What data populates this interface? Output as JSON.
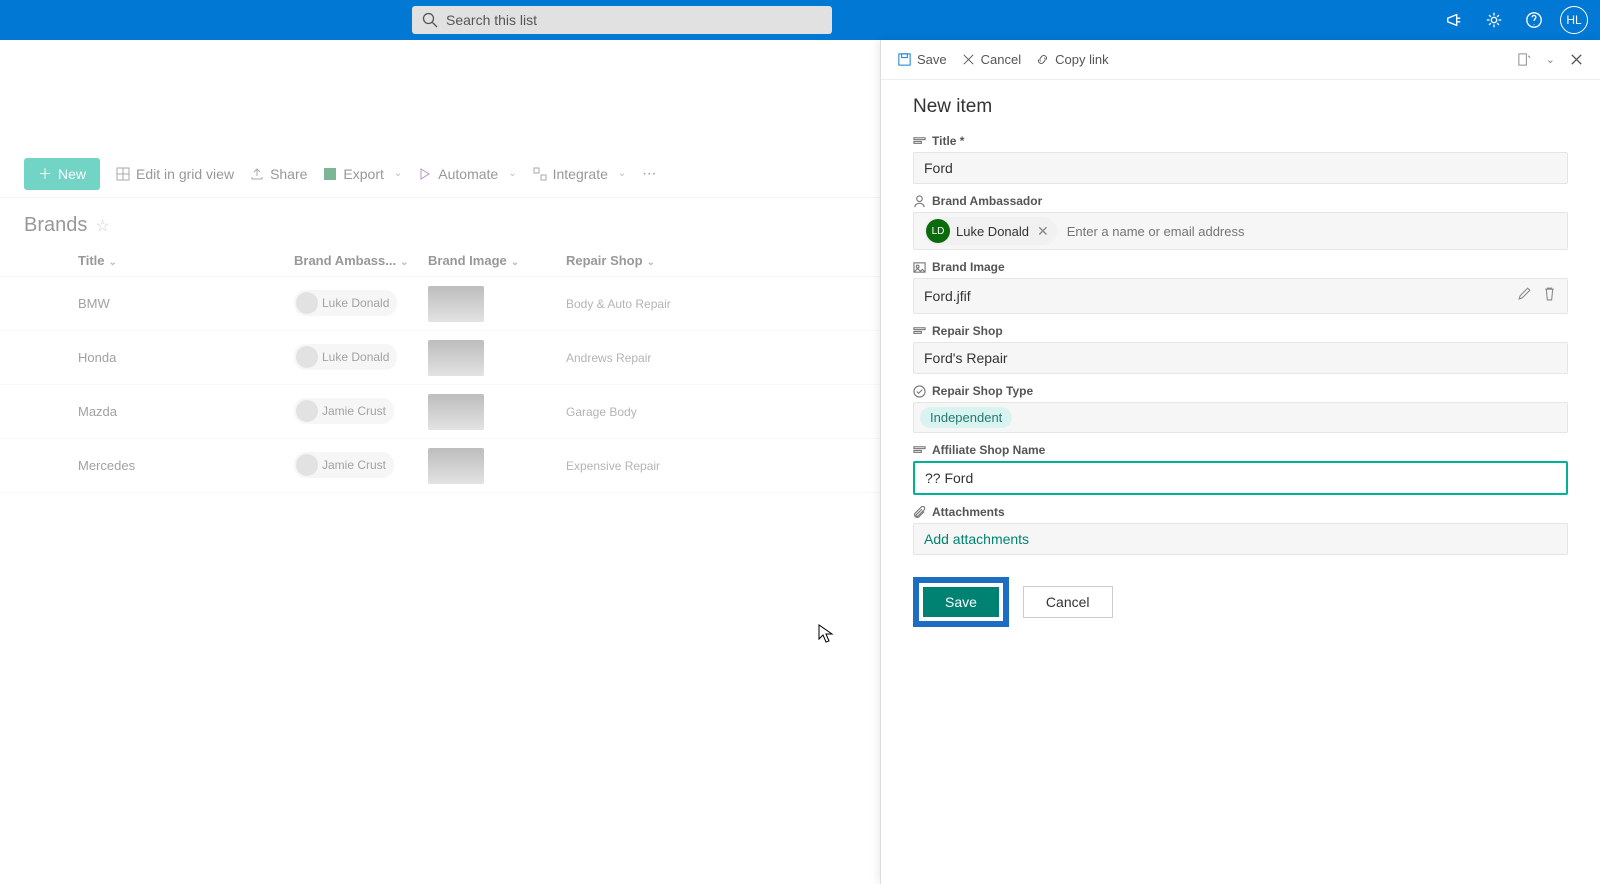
{
  "topbar": {
    "search_placeholder": "Search this list",
    "avatar_initials": "HL"
  },
  "commandbar": {
    "new_label": "New",
    "edit_grid": "Edit in grid view",
    "share": "Share",
    "export": "Export",
    "automate": "Automate",
    "integrate": "Integrate"
  },
  "list": {
    "title": "Brands",
    "columns": {
      "title": "Title",
      "ambassador": "Brand Ambass...",
      "image": "Brand Image",
      "shop": "Repair Shop"
    },
    "rows": [
      {
        "title": "BMW",
        "ambassador": "Luke Donald",
        "shop": "Body & Auto Repair"
      },
      {
        "title": "Honda",
        "ambassador": "Luke Donald",
        "shop": "Andrews Repair"
      },
      {
        "title": "Mazda",
        "ambassador": "Jamie Crust",
        "shop": "Garage Body"
      },
      {
        "title": "Mercedes",
        "ambassador": "Jamie Crust",
        "shop": "Expensive Repair"
      }
    ]
  },
  "panel": {
    "header": {
      "save": "Save",
      "cancel": "Cancel",
      "copy_link": "Copy link"
    },
    "title": "New item",
    "fields": {
      "title_label": "Title *",
      "title_value": "Ford",
      "ambassador_label": "Brand Ambassador",
      "ambassador_value": "Luke Donald",
      "ambassador_initials": "LD",
      "ambassador_placeholder": "Enter a name or email address",
      "image_label": "Brand Image",
      "image_value": "Ford.jfif",
      "shop_label": "Repair Shop",
      "shop_value": "Ford's Repair",
      "shoptype_label": "Repair Shop Type",
      "shoptype_value": "Independent",
      "affiliate_label": "Affiliate Shop Name",
      "affiliate_value": "?? Ford",
      "attachments_label": "Attachments",
      "attachments_link": "Add attachments"
    },
    "buttons": {
      "save": "Save",
      "cancel": "Cancel"
    }
  }
}
